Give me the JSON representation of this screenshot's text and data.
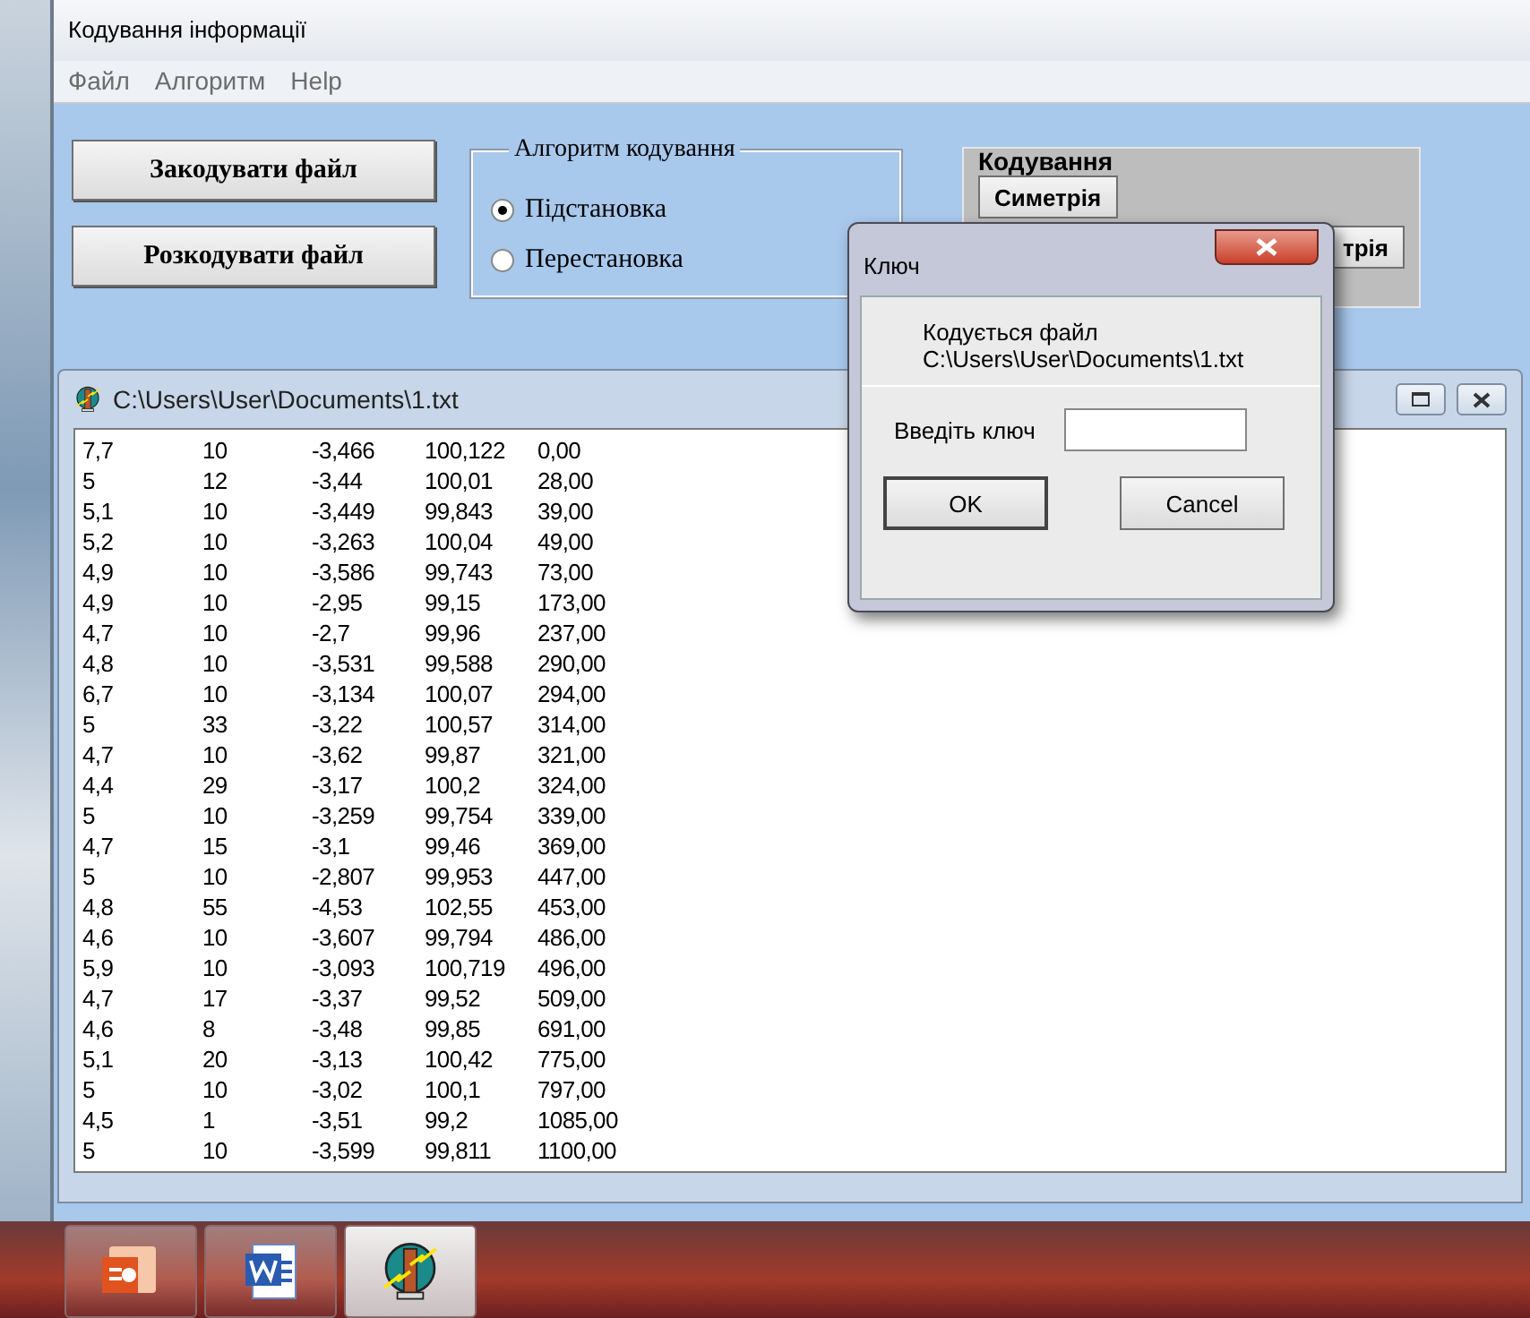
{
  "window": {
    "title": "Кодування інформації"
  },
  "menu": [
    "Файл",
    "Алгоритм",
    "Help"
  ],
  "buttons": [
    "Закодувати файл",
    "Розкодувати файл"
  ],
  "algorithm_group": {
    "title": "Алгоритм кодування",
    "options": [
      {
        "label": "Підстановка",
        "selected": true
      },
      {
        "label": "Перестановка",
        "selected": false
      }
    ]
  },
  "coding_group": {
    "title": "Кодування",
    "buttons": [
      "Симетрія",
      "трія"
    ]
  },
  "document": {
    "title": "C:\\Users\\User\\Documents\\1.txt",
    "rows": [
      [
        "7,7",
        "10",
        "-3,466",
        "100,122",
        "0,00"
      ],
      [
        "5",
        "12",
        "-3,44",
        "100,01",
        "28,00"
      ],
      [
        "5,1",
        "10",
        "-3,449",
        "99,843",
        "39,00"
      ],
      [
        "5,2",
        "10",
        "-3,263",
        "100,04",
        "49,00"
      ],
      [
        "4,9",
        "10",
        "-3,586",
        "99,743",
        "73,00"
      ],
      [
        "4,9",
        "10",
        "-2,95",
        "99,15",
        "173,00"
      ],
      [
        "4,7",
        "10",
        "-2,7",
        "99,96",
        "237,00"
      ],
      [
        "4,8",
        "10",
        "-3,531",
        "99,588",
        "290,00"
      ],
      [
        "6,7",
        "10",
        "-3,134",
        "100,07",
        "294,00"
      ],
      [
        "5",
        "33",
        "-3,22",
        "100,57",
        "314,00"
      ],
      [
        "4,7",
        "10",
        "-3,62",
        "99,87",
        "321,00"
      ],
      [
        "4,4",
        "29",
        "-3,17",
        "100,2",
        "324,00"
      ],
      [
        "5",
        "10",
        "-3,259",
        "99,754",
        "339,00"
      ],
      [
        "4,7",
        "15",
        "-3,1",
        "99,46",
        "369,00"
      ],
      [
        "5",
        "10",
        "-2,807",
        "99,953",
        "447,00"
      ],
      [
        "4,8",
        "55",
        "-4,53",
        "102,55",
        "453,00"
      ],
      [
        "4,6",
        "10",
        "-3,607",
        "99,794",
        "486,00"
      ],
      [
        "5,9",
        "10",
        "-3,093",
        "100,719",
        "496,00"
      ],
      [
        "4,7",
        "17",
        "-3,37",
        "99,52",
        "509,00"
      ],
      [
        "4,6",
        "8",
        "-3,48",
        "99,85",
        "691,00"
      ],
      [
        "5,1",
        "20",
        "-3,13",
        "100,42",
        "775,00"
      ],
      [
        "5",
        "10",
        "-3,02",
        "100,1",
        "797,00"
      ],
      [
        "4,5",
        "1",
        "-3,51",
        "99,2",
        "1085,00"
      ],
      [
        "5",
        "10",
        "-3,599",
        "99,811",
        "1100,00"
      ]
    ]
  },
  "dialog": {
    "title": "Ключ",
    "message": [
      "Кодується файл",
      "C:\\Users\\User\\Documents\\1.txt"
    ],
    "key_label": "Введіть ключ",
    "buttons": [
      "OK",
      "Cancel"
    ]
  },
  "taskbar": [
    {
      "kind": "presentation"
    },
    {
      "kind": "document"
    },
    {
      "kind": "app"
    }
  ]
}
